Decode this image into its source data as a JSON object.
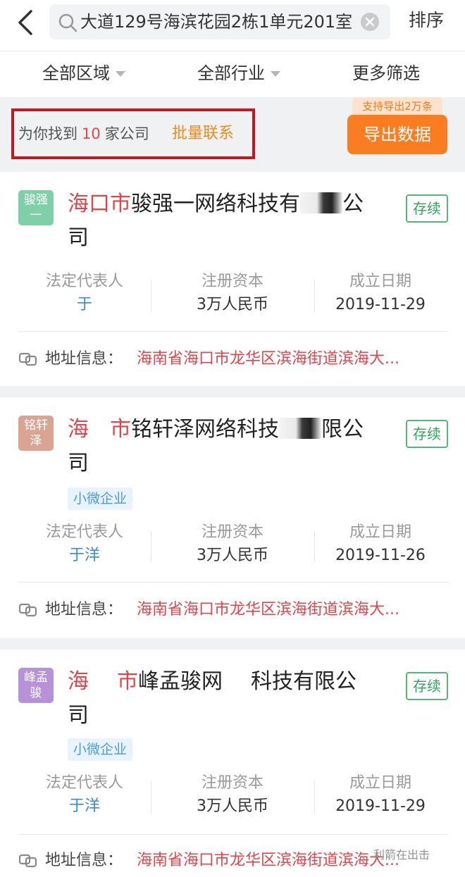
{
  "header": {
    "search_value": "大道129号海滨花园2栋1单元201室",
    "sort_label": "排序"
  },
  "filters": [
    {
      "label": "全部区域"
    },
    {
      "label": "全部行业"
    },
    {
      "label": "更多筛选"
    }
  ],
  "summary": {
    "prefix": "为你找到",
    "count": "10",
    "suffix": "家公司",
    "bulk_contact": "批量联系",
    "export_tag": "支持导出2万条",
    "export_button": "导出数据"
  },
  "companies": [
    {
      "logo_text": "骏强一",
      "logo_color": "#7fcfa8",
      "name_red": "海口市",
      "name_rest": "骏强一网络科技有",
      "name_tail": "公",
      "name_line2": "司",
      "status": "存续",
      "tag": "",
      "legal_rep_label": "法定代表人",
      "legal_rep": "于",
      "capital_label": "注册资本",
      "capital": "3万人民币",
      "date_label": "成立日期",
      "date": "2019-11-29",
      "address_label": "地址信息：",
      "address": "海南省海口市龙华区滨海街道滨海大..."
    },
    {
      "logo_text": "铭轩泽",
      "logo_color": "#d9a592",
      "name_red": "海",
      "name_red2": "市",
      "name_rest": "铭轩泽网络科技",
      "name_tail": "限公",
      "name_line2": "司",
      "status": "存续",
      "tag": "小微企业",
      "legal_rep_label": "法定代表人",
      "legal_rep": "于洋",
      "capital_label": "注册资本",
      "capital": "3万人民币",
      "date_label": "成立日期",
      "date": "2019-11-26",
      "address_label": "地址信息：",
      "address": "海南省海口市龙华区滨海街道滨海大..."
    },
    {
      "logo_text": "峰孟骏",
      "logo_color": "#b892d6",
      "name_red": "海",
      "name_red2": "市",
      "name_rest": "峰孟骏网",
      "name_tail": "科技有限公司",
      "name_line2": "司",
      "status": "存续",
      "tag": "小微企业",
      "legal_rep_label": "法定代表人",
      "legal_rep": "于洋",
      "capital_label": "注册资本",
      "capital": "3万人民币",
      "date_label": "成立日期",
      "date": "2019-11-29",
      "address_label": "地址信息：",
      "address": "海南省海口市龙华区滨海街道滨海大..."
    }
  ],
  "watermark": "利箭在出击"
}
